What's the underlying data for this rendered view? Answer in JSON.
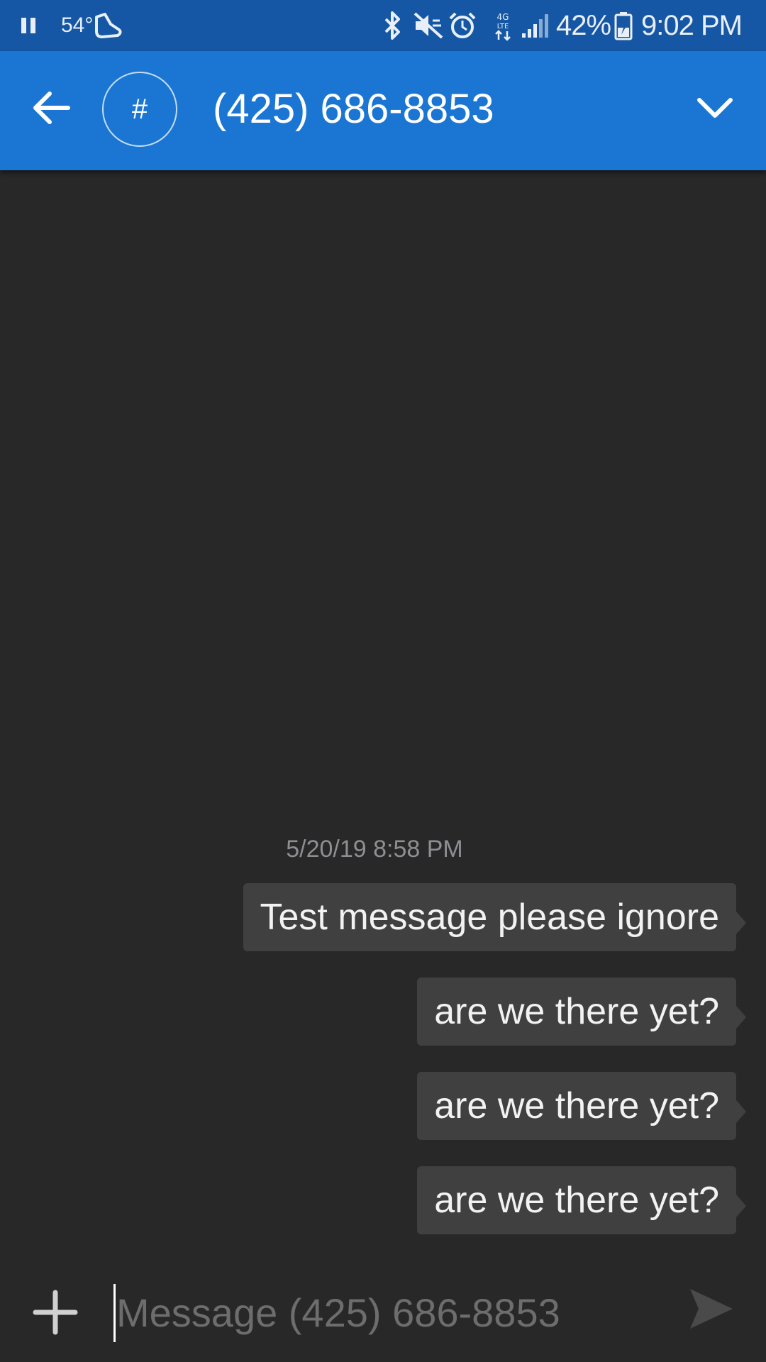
{
  "status_bar": {
    "temperature": "54°",
    "battery_percent": "42%",
    "time": "9:02 PM",
    "network_label": "4G LTE",
    "icons": [
      "pause-icon",
      "weather-icon",
      "shoe-icon",
      "bluetooth-icon",
      "mute-icon",
      "alarm-icon",
      "lte-data-icon",
      "signal-icon",
      "battery-charging-icon"
    ]
  },
  "app_bar": {
    "avatar_symbol": "#",
    "contact_title": "(425) 686-8853",
    "color": "#1a76d2",
    "status_color": "#1557a4"
  },
  "conversation": {
    "timestamp": "5/20/19 8:58 PM",
    "messages": [
      {
        "text": "Test message please ignore",
        "direction": "outgoing"
      },
      {
        "text": "are we there yet?",
        "direction": "outgoing"
      },
      {
        "text": "are we there yet?",
        "direction": "outgoing"
      },
      {
        "text": "are we there yet?",
        "direction": "outgoing"
      }
    ]
  },
  "compose": {
    "value": "",
    "placeholder": "Message (425) 686-8853"
  },
  "colors": {
    "background": "#282828",
    "bubble": "#404040"
  }
}
